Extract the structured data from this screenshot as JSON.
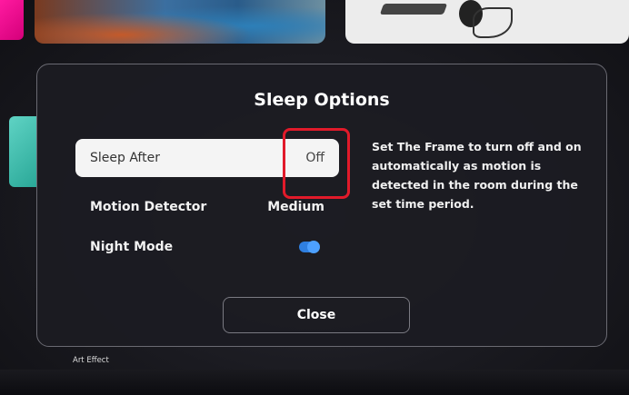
{
  "dialog": {
    "title": "Sleep Options",
    "options": [
      {
        "label": "Sleep After",
        "value": "Off",
        "selected": true
      },
      {
        "label": "Motion Detector",
        "value": "Medium",
        "selected": false
      },
      {
        "label": "Night Mode",
        "toggle_on": true,
        "selected": false
      }
    ],
    "description": "Set The Frame to turn off and on automatically as motion is detected in the room during the set time period.",
    "close_label": "Close"
  },
  "footer": {
    "label": "Art Effect"
  },
  "colors": {
    "highlight_box": "#e11a2a",
    "toggle_on": "#2f7fe0",
    "selected_row_bg": "#f4f4f4"
  },
  "icons": {
    "night_mode_toggle": "toggle-switch-on"
  }
}
